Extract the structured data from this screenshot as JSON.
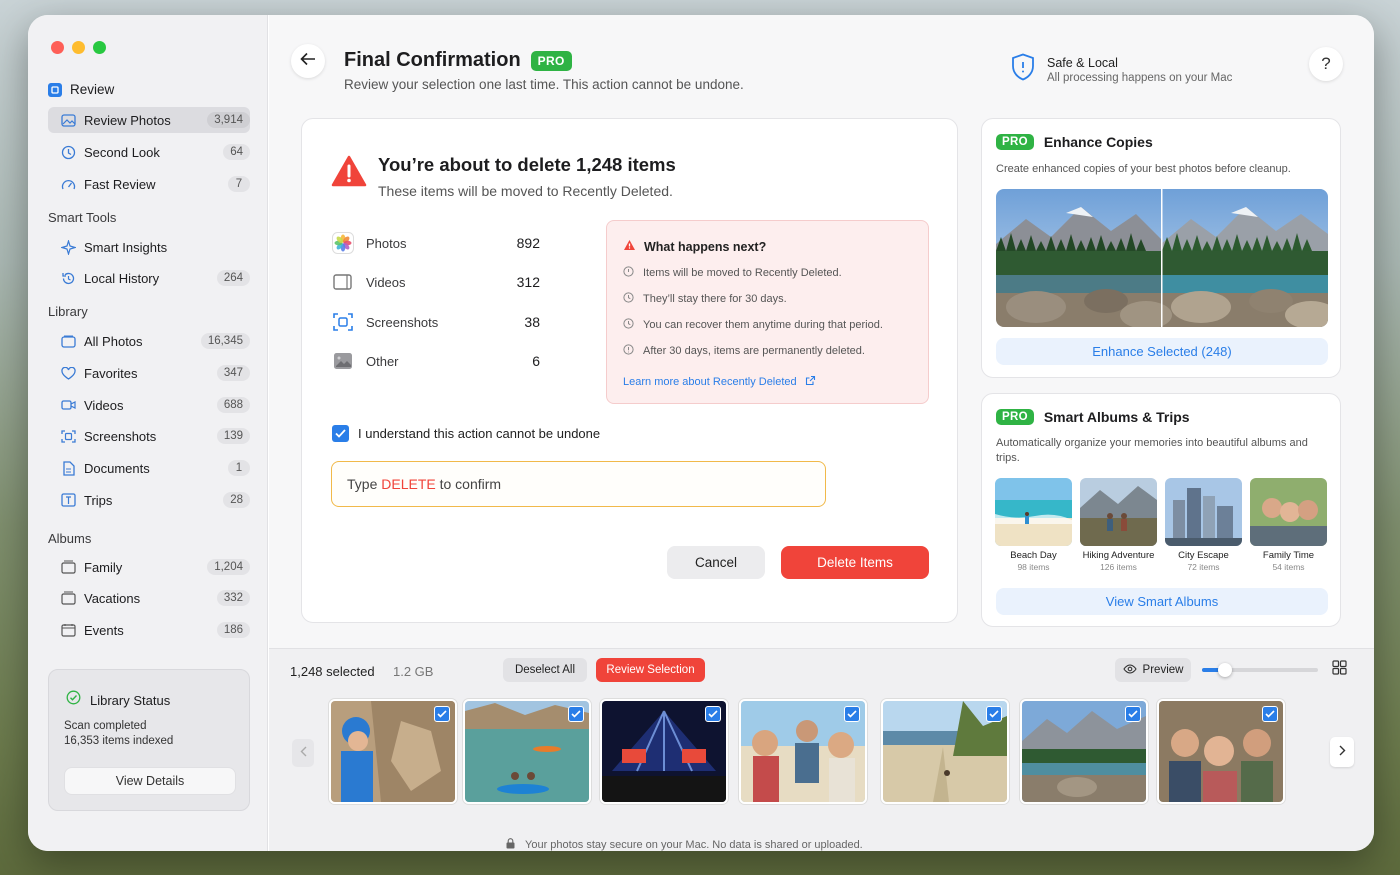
{
  "sidebar": {
    "review_header": "Review",
    "review_items": [
      {
        "label": "Review Photos",
        "count": "3,914"
      },
      {
        "label": "Second Look",
        "count": "64"
      },
      {
        "label": "Fast Review",
        "count": "7"
      }
    ],
    "smart_tools_header": "Smart Tools",
    "smart_tools_items": [
      {
        "label": "Smart Insights",
        "count": ""
      },
      {
        "label": "Local History",
        "count": "264"
      }
    ],
    "library_header": "Library",
    "library_items": [
      {
        "label": "All Photos",
        "count": "16,345"
      },
      {
        "label": "Favorites",
        "count": "347"
      },
      {
        "label": "Videos",
        "count": "688"
      },
      {
        "label": "Screenshots",
        "count": "139"
      },
      {
        "label": "Documents",
        "count": "1"
      },
      {
        "label": "Trips",
        "count": "28"
      }
    ],
    "albums_header": "Albums",
    "albums_items": [
      {
        "label": "Family",
        "count": "1,204"
      },
      {
        "label": "Vacations",
        "count": "332"
      },
      {
        "label": "Events",
        "count": "186"
      }
    ],
    "status": {
      "title": "Library Status",
      "line1": "Scan completed",
      "line2": "16,353 items indexed",
      "button": "View Details"
    }
  },
  "header": {
    "title": "Final Confirmation",
    "badge": "PRO",
    "subtitle": "Review your selection one last time. This action cannot be undone.",
    "safe_title": "Safe & Local",
    "safe_sub": "All processing happens on your Mac",
    "help": "?"
  },
  "confirm": {
    "title": "You’re about to delete 1,248 items",
    "subtitle": "These items will be moved to Recently Deleted.",
    "rows": [
      {
        "label": "Photos",
        "value": "892"
      },
      {
        "label": "Videos",
        "value": "312"
      },
      {
        "label": "Screenshots",
        "value": "38"
      },
      {
        "label": "Other",
        "value": "6"
      }
    ],
    "next_title": "What happens next?",
    "next_items": [
      "Items will be moved to Recently Deleted.",
      "They’ll stay there for 30 days.",
      "You can recover them anytime during that period.",
      "After 30 days, items are permanently deleted."
    ],
    "learn_more": "Learn more about Recently Deleted",
    "checkbox_label": "I understand this action cannot be undone",
    "input_prefix": "Type ",
    "input_keyword": "DELETE",
    "input_suffix": " to confirm",
    "cancel": "Cancel",
    "delete": "Delete Items"
  },
  "enhance": {
    "badge": "PRO",
    "title": "Enhance Copies",
    "desc": "Create enhanced copies of your best photos before cleanup.",
    "button": "Enhance Selected (248)"
  },
  "smart_albums": {
    "badge": "PRO",
    "title": "Smart Albums & Trips",
    "desc": "Automatically organize your memories into beautiful albums and trips.",
    "albums": [
      {
        "title": "Beach Day",
        "sub": "98 items"
      },
      {
        "title": "Hiking Adventure",
        "sub": "126 items"
      },
      {
        "title": "City Escape",
        "sub": "72 items"
      },
      {
        "title": "Family Time",
        "sub": "54 items"
      }
    ],
    "button": "View Smart Albums"
  },
  "bottom": {
    "selected": "1,248 selected",
    "size": "1.2 GB",
    "deselect": "Deselect All",
    "review": "Review Selection",
    "preview": "Preview",
    "zoom_level": 0.2,
    "footer": "Your photos stay secure on your Mac. No data is shared or uploaded."
  },
  "colors": {
    "accent": "#2a7ee8",
    "danger": "#f0443a",
    "pro": "#2fb344"
  }
}
